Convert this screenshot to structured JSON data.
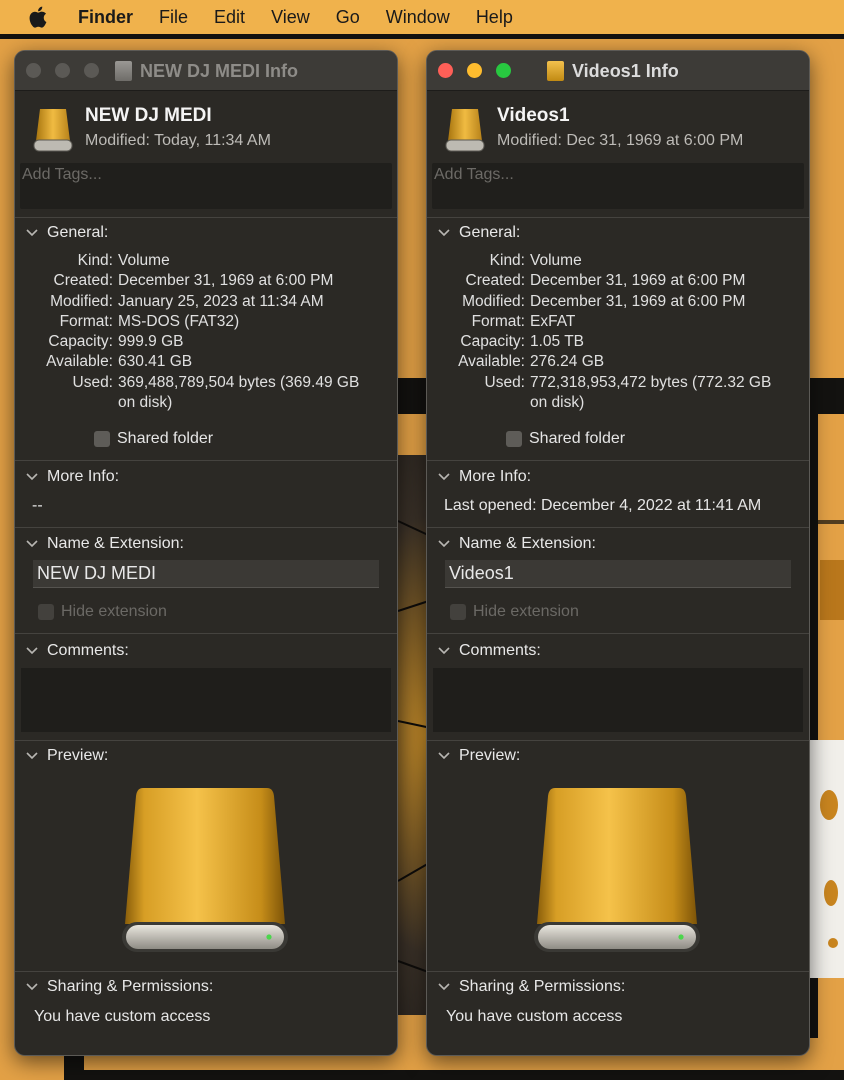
{
  "menubar": {
    "app_name": "Finder",
    "items": [
      "File",
      "Edit",
      "View",
      "Go",
      "Window",
      "Help"
    ]
  },
  "windows": [
    {
      "title": "NEW DJ MEDI Info",
      "name": "NEW DJ MEDI",
      "modified": "Modified: Today, 11:34 AM",
      "tags_placeholder": "Add Tags...",
      "general_label": "General:",
      "general": [
        {
          "key": "Kind:",
          "value": "Volume"
        },
        {
          "key": "Created:",
          "value": "December 31, 1969 at 6:00 PM"
        },
        {
          "key": "Modified:",
          "value": "January 25, 2023 at 11:34 AM"
        },
        {
          "key": "Format:",
          "value": "MS-DOS (FAT32)"
        },
        {
          "key": "Capacity:",
          "value": "999.9 GB"
        },
        {
          "key": "Available:",
          "value": "630.41 GB"
        },
        {
          "key": "Used:",
          "value": "369,488,789,504 bytes (369.49 GB on disk)"
        }
      ],
      "shared_folder": "Shared folder",
      "more_info_label": "More Info:",
      "more_info": "--",
      "name_ext_label": "Name & Extension:",
      "name_field": "NEW DJ MEDI",
      "hide_extension": "Hide extension",
      "comments_label": "Comments:",
      "preview_label": "Preview:",
      "sharing_label": "Sharing & Permissions:",
      "sharing_text": "You have custom access"
    },
    {
      "title": "Videos1 Info",
      "name": "Videos1",
      "modified": "Modified: Dec 31, 1969 at 6:00 PM",
      "tags_placeholder": "Add Tags...",
      "general_label": "General:",
      "general": [
        {
          "key": "Kind:",
          "value": "Volume"
        },
        {
          "key": "Created:",
          "value": "December 31, 1969 at 6:00 PM"
        },
        {
          "key": "Modified:",
          "value": "December 31, 1969 at 6:00 PM"
        },
        {
          "key": "Format:",
          "value": "ExFAT"
        },
        {
          "key": "Capacity:",
          "value": "1.05 TB"
        },
        {
          "key": "Available:",
          "value": "276.24 GB"
        },
        {
          "key": "Used:",
          "value": "772,318,953,472 bytes (772.32 GB on disk)"
        }
      ],
      "shared_folder": "Shared folder",
      "more_info_label": "More Info:",
      "more_info": "Last opened: December 4, 2022 at 11:41 AM",
      "name_ext_label": "Name & Extension:",
      "name_field": "Videos1",
      "hide_extension": "Hide extension",
      "comments_label": "Comments:",
      "preview_label": "Preview:",
      "sharing_label": "Sharing & Permissions:",
      "sharing_text": "You have custom access"
    }
  ],
  "colors": {
    "menubar": "#f0b24c",
    "window_bg": "#2b2925",
    "drive_gold": "#e2a52a",
    "traffic_close": "#fe5f57",
    "traffic_min": "#febc2e",
    "traffic_zoom": "#28c840"
  }
}
